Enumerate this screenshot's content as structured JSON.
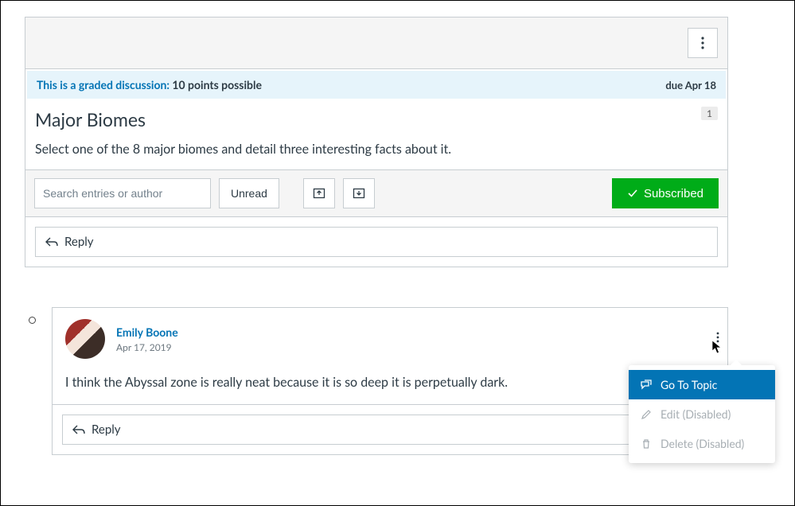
{
  "graded": {
    "label": "This is a graded discussion:",
    "points": "10 points possible",
    "due": "due Apr 18"
  },
  "discussion": {
    "title": "Major Biomes",
    "description": "Select one of the 8 major biomes and detail three interesting facts about it.",
    "reply_count": "1"
  },
  "toolbar": {
    "search_placeholder": "Search entries or author",
    "unread_label": "Unread",
    "subscribed_label": "Subscribed"
  },
  "reply": {
    "label": "Reply"
  },
  "entry": {
    "author": "Emily Boone",
    "timestamp": "Apr 17, 2019",
    "body": "I think the Abyssal zone is really neat because it is so deep it is perpetually dark.",
    "reply_label": "Reply"
  },
  "menu": {
    "go_to_topic": "Go To Topic",
    "edit": "Edit (Disabled)",
    "delete": "Delete (Disabled)"
  }
}
